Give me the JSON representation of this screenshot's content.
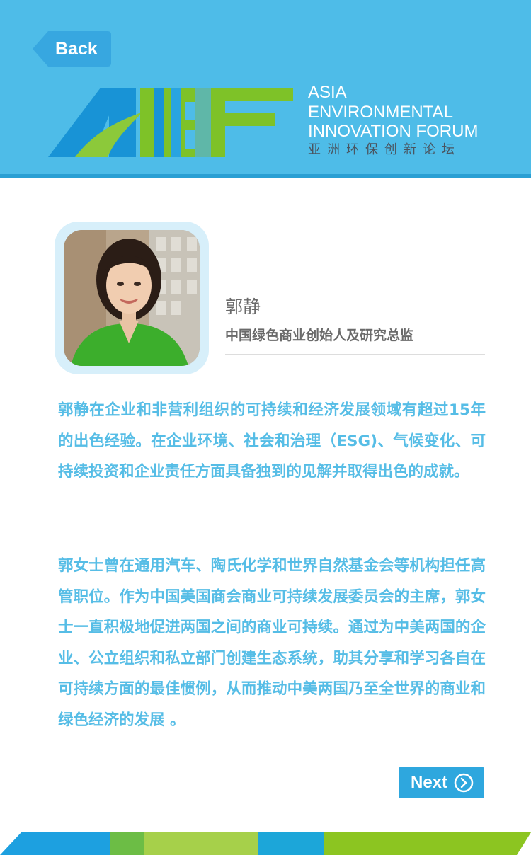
{
  "nav": {
    "back_label": "Back",
    "next_label": "Next"
  },
  "logo": {
    "lines": [
      "ASIA",
      "ENVIRONMENTAL",
      "INNOVATION FORUM"
    ],
    "cn": "亚洲环保创新论坛"
  },
  "speaker": {
    "name": "郭静",
    "title": "中国绿色商业创始人及研究总监"
  },
  "bio": {
    "paragraph_1": "郭静在企业和非营利组织的可持续和经济发展领域有超过15年的出色经验。在企业环境、社会和治理（ESG)、气候变化、可持续投资和企业责任方面具备独到的见解并取得出色的成就。",
    "paragraph_2": "郭女士曾在通用汽车、陶氏化学和世界自然基金会等机构担任高管职位。作为中国美国商会商业可持续发展委员会的主席，郭女士一直积极地促进两国之间的商业可持续。通过为中美两国的企业、公立组织和私立部门创建生态系统，助其分享和学习各自在可持续方面的最佳惯例，从而推动中美两国乃至全世界的商业和绿色经济的发展 。"
  },
  "colors": {
    "header_bg": "#4ebce8",
    "bio_text": "#56bde6",
    "button_bg": "#2ea7de",
    "logo_blue": "#1893d6",
    "logo_green": "#7ec228"
  },
  "icons": {
    "back": "back-arrow-icon",
    "next": "chevron-right-circle-icon"
  }
}
